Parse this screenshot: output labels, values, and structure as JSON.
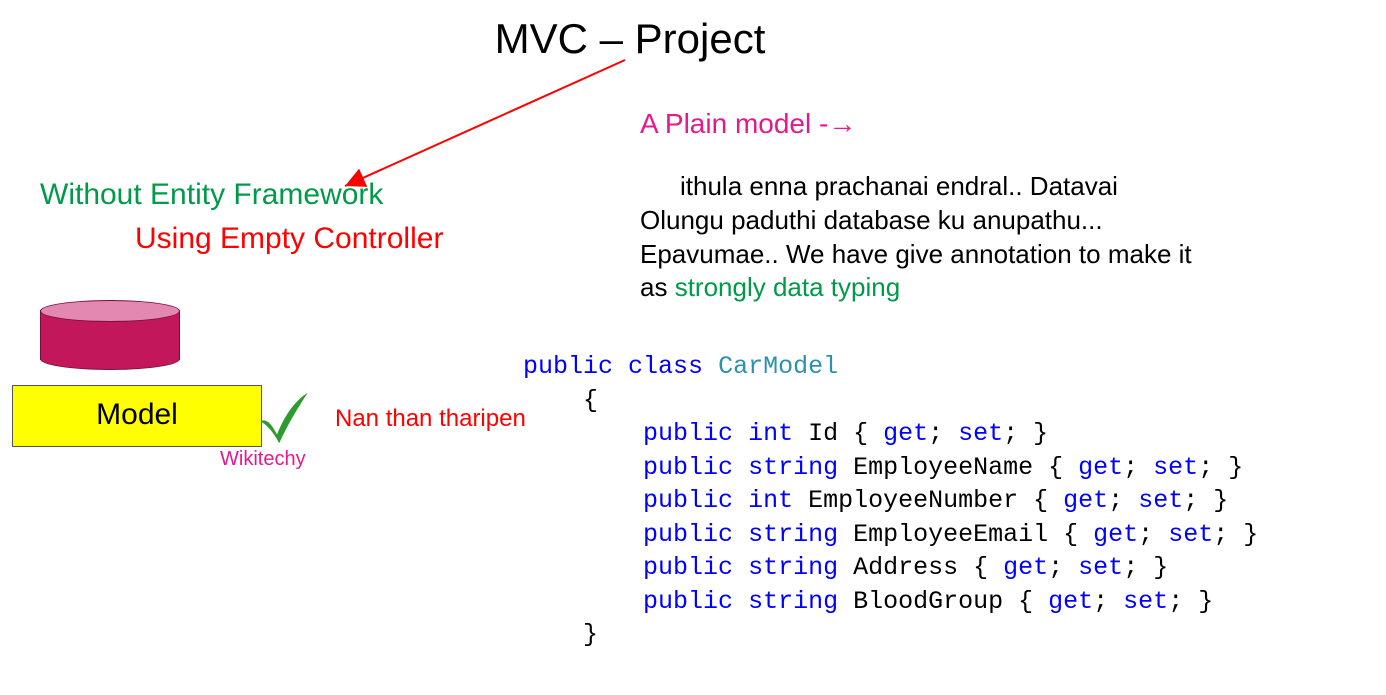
{
  "title": "MVC – Project",
  "pink_heading": "A Plain model -",
  "pink_arrow": "→",
  "paragraph": {
    "l1_indent": true,
    "l1": "ithula enna prachanai endral.. Datavai",
    "l2": "Olungu paduthi database ku anupathu...",
    "l3": "Epavumae.. We have give annotation to make it",
    "l4_pre": "as ",
    "l4_strong": "strongly data typing"
  },
  "left": {
    "green": "Without Entity Framework",
    "red": "Using Empty Controller",
    "model_label": "Model",
    "nan_than": "Nan than tharipen",
    "watermark": "Wikitechy"
  },
  "icons": {
    "cylinder": "database-icon",
    "check": "checkmark-icon",
    "arrow": "arrow-icon"
  },
  "colors": {
    "green": "#009a49",
    "red": "#ff0000",
    "pink": "#e6198c",
    "yellow": "#ffff00",
    "kw_blue": "#0000ff",
    "type_teal": "#2b91af",
    "cyl_dark": "#c2185b",
    "cyl_light": "#e388b0"
  },
  "code": {
    "kw_public": "public",
    "kw_class": "class",
    "class_name": "CarModel",
    "brace_open": "{",
    "brace_close": "}",
    "kw_int": "int",
    "kw_string": "string",
    "kw_get": "get",
    "kw_set": "set",
    "props": {
      "p1": "Id",
      "p2": "EmployeeName",
      "p3": "EmployeeNumber",
      "p4": "EmployeeEmail",
      "p5": "Address",
      "p6": "BloodGroup"
    }
  }
}
